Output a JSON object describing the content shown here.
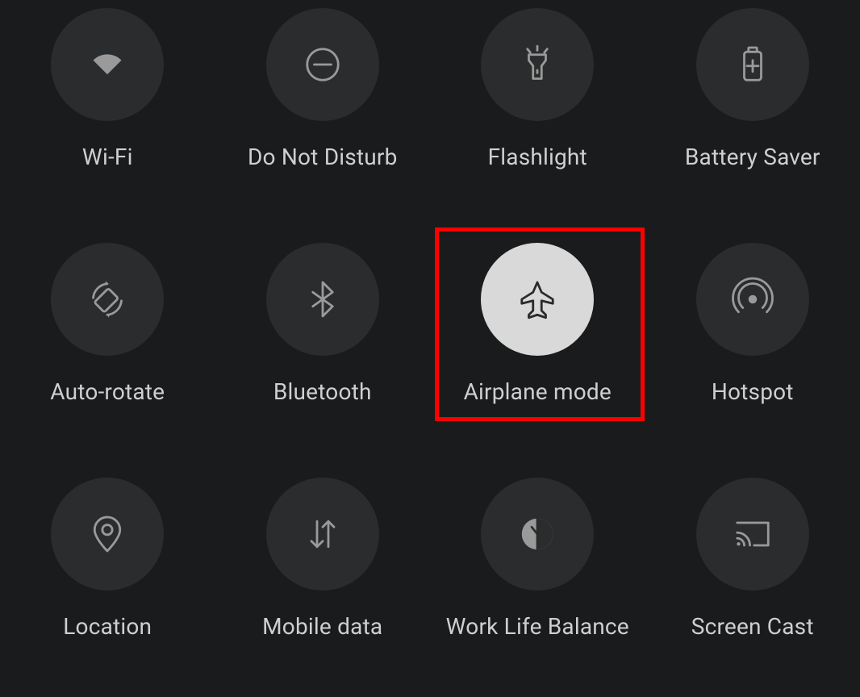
{
  "tiles": [
    {
      "id": "wifi",
      "label": "Wi-Fi",
      "active": false
    },
    {
      "id": "dnd",
      "label": "Do Not Disturb",
      "active": false
    },
    {
      "id": "flashlight",
      "label": "Flashlight",
      "active": false
    },
    {
      "id": "battery",
      "label": "Battery Saver",
      "active": false
    },
    {
      "id": "autorotate",
      "label": "Auto-rotate",
      "active": false
    },
    {
      "id": "bluetooth",
      "label": "Bluetooth",
      "active": false
    },
    {
      "id": "airplane",
      "label": "Airplane mode",
      "active": true
    },
    {
      "id": "hotspot",
      "label": "Hotspot",
      "active": false
    },
    {
      "id": "location",
      "label": "Location",
      "active": false
    },
    {
      "id": "mobiledata",
      "label": "Mobile data",
      "active": false
    },
    {
      "id": "worklife",
      "label": "Work Life Balance",
      "active": false
    },
    {
      "id": "screencast",
      "label": "Screen Cast",
      "active": false
    }
  ],
  "highlight": {
    "target": "airplane",
    "color": "#ff0000"
  }
}
